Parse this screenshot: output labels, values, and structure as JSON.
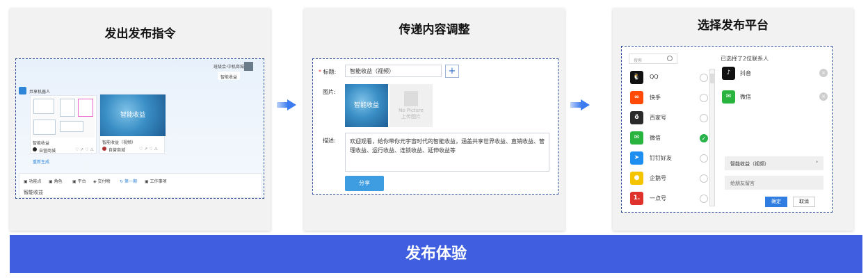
{
  "steps": [
    {
      "title": "发出发布指令"
    },
    {
      "title": "传递内容调整"
    },
    {
      "title": "选择发布平台"
    }
  ],
  "banner": "发布体验",
  "step1": {
    "user_caption": "班级会·中机商城",
    "bubble": "智能收益",
    "bot_name": "共享机器人",
    "card1_title": "智能收益",
    "card1_author": "自营商城",
    "card2_thumb": "智能收益",
    "card2_title": "智能收益（视频）",
    "card2_author": "自营商城",
    "regen": "重新生成",
    "toolbar": [
      "功能点",
      "角色",
      "平台",
      "交付物",
      "第一期",
      "工作事项"
    ],
    "input_value": "智能收益"
  },
  "step2": {
    "title_label": "标题:",
    "title_value": "智能收益（视频）",
    "plus": "+",
    "image_label": "图片:",
    "thumb_text": "智能收益",
    "nopic_line1": "No Picture",
    "nopic_line2": "上传图片",
    "desc_label": "描述:",
    "desc_value": "欢迎观看，给你带你元宇宙时代的智能收益，涵盖共享世界收益、直销收益、管理收益、运行收益、连锁收益、延伸收益等",
    "share_button": "分享"
  },
  "step3": {
    "search_placeholder": "搜索",
    "platforms": [
      {
        "name": "QQ",
        "icon": "qq-icon",
        "color": "#111111",
        "checked": false
      },
      {
        "name": "快手",
        "icon": "kuaishou-icon",
        "color": "#ff4906",
        "checked": false
      },
      {
        "name": "百家号",
        "icon": "baijiahao-icon",
        "color": "#2a2a2a",
        "checked": false
      },
      {
        "name": "微信",
        "icon": "wechat-icon",
        "color": "#29b43f",
        "checked": true
      },
      {
        "name": "钉钉好友",
        "icon": "dingtalk-icon",
        "color": "#1f8ef1",
        "checked": false
      },
      {
        "name": "企鹅号",
        "icon": "qiehao-icon",
        "color": "#f5c400",
        "checked": false
      },
      {
        "name": "一点号",
        "icon": "yidianhao-icon",
        "color": "#e0322c",
        "checked": false
      }
    ],
    "selected_caption": "已选择了2位联系人",
    "selected": [
      {
        "name": "抖音",
        "icon": "douyin-icon",
        "color": "#111111"
      },
      {
        "name": "微信",
        "icon": "wechat-icon",
        "color": "#29b43f"
      }
    ],
    "content_item": "智能收益（视频）",
    "message_placeholder": "给朋友留言",
    "ok_button": "确定",
    "cancel_button": "取消"
  }
}
